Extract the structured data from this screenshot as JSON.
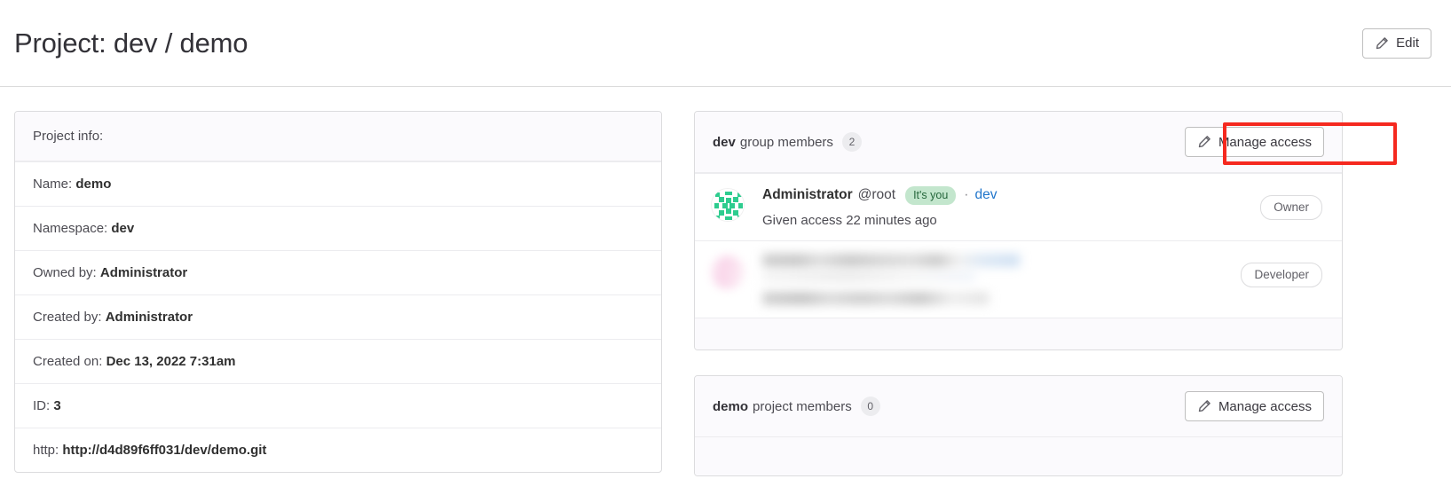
{
  "header": {
    "title": "Project: dev / demo",
    "edit_button": "Edit"
  },
  "project_info": {
    "heading": "Project info:",
    "rows": [
      {
        "label": "Name:",
        "value": "demo"
      },
      {
        "label": "Namespace:",
        "value": "dev"
      },
      {
        "label": "Owned by:",
        "value": "Administrator"
      },
      {
        "label": "Created by:",
        "value": "Administrator"
      },
      {
        "label": "Created on:",
        "value": "Dec 13, 2022 7:31am"
      },
      {
        "label": "ID:",
        "value": "3"
      },
      {
        "label": "http:",
        "value": "http://d4d89f6ff031/dev/demo.git"
      }
    ]
  },
  "group_members": {
    "name": "dev",
    "title_suffix": "group members",
    "count": "2",
    "manage_access_button": "Manage access",
    "members": [
      {
        "name": "Administrator",
        "handle": "@root",
        "badge": "It's you",
        "separator": "·",
        "group_link": "dev",
        "access_text": "Given access 22 minutes ago",
        "role": "Owner"
      },
      {
        "name": "",
        "handle": "",
        "badge": "",
        "separator": "",
        "group_link": "",
        "access_text": "",
        "role": "Developer"
      }
    ]
  },
  "project_members": {
    "name": "demo",
    "title_suffix": "project members",
    "count": "0",
    "manage_access_button": "Manage access"
  },
  "colors": {
    "highlight": "#f5291f",
    "link": "#1f75cb",
    "badge_green_bg": "#c3e6cd",
    "badge_green_text": "#24663b",
    "avatar_green": "#2ecc8f"
  }
}
